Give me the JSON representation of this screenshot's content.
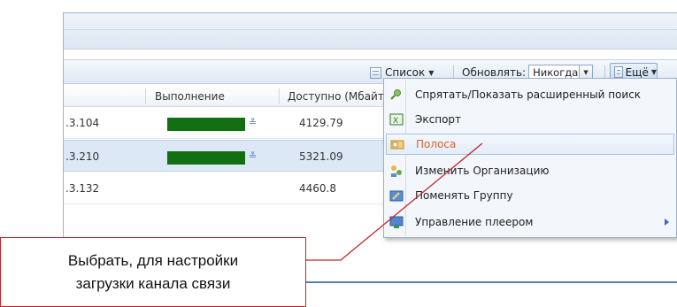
{
  "toolbar": {
    "list_label": "Список",
    "refresh_label": "Обновлять:",
    "refresh_value": "Никогда",
    "more_label": "Ещё"
  },
  "table": {
    "columns": [
      "Выполнение",
      "Доступно (Мбайт"
    ],
    "rows": [
      {
        "ip": ".3.104",
        "progress": 1.0,
        "available": "4129.79",
        "selected": false
      },
      {
        "ip": ".3.210",
        "progress": 1.0,
        "available": "5321.09",
        "selected": true
      },
      {
        "ip": ".3.132",
        "progress": 0.0,
        "available": "4460.8",
        "selected": false
      }
    ]
  },
  "menu": {
    "items": [
      {
        "label": "Спрятать/Показать расширенный поиск",
        "icon": "search-toggle-icon"
      },
      {
        "label": "Экспорт",
        "icon": "excel-export-icon"
      },
      {
        "label": "Полоса",
        "icon": "bandwidth-icon",
        "active": true
      },
      {
        "label": "Изменить Организацию",
        "icon": "organization-icon"
      },
      {
        "label": "Поменять Группу",
        "icon": "group-icon"
      },
      {
        "label": "Управление плеером",
        "icon": "player-icon",
        "submenu": true
      }
    ]
  },
  "callout": {
    "line1": "Выбрать, для настройки",
    "line2": "загрузки канала связи",
    "color": "#c0262c"
  },
  "colors": {
    "progress_bar": "#127012",
    "active_item_text": "#d4642a"
  }
}
